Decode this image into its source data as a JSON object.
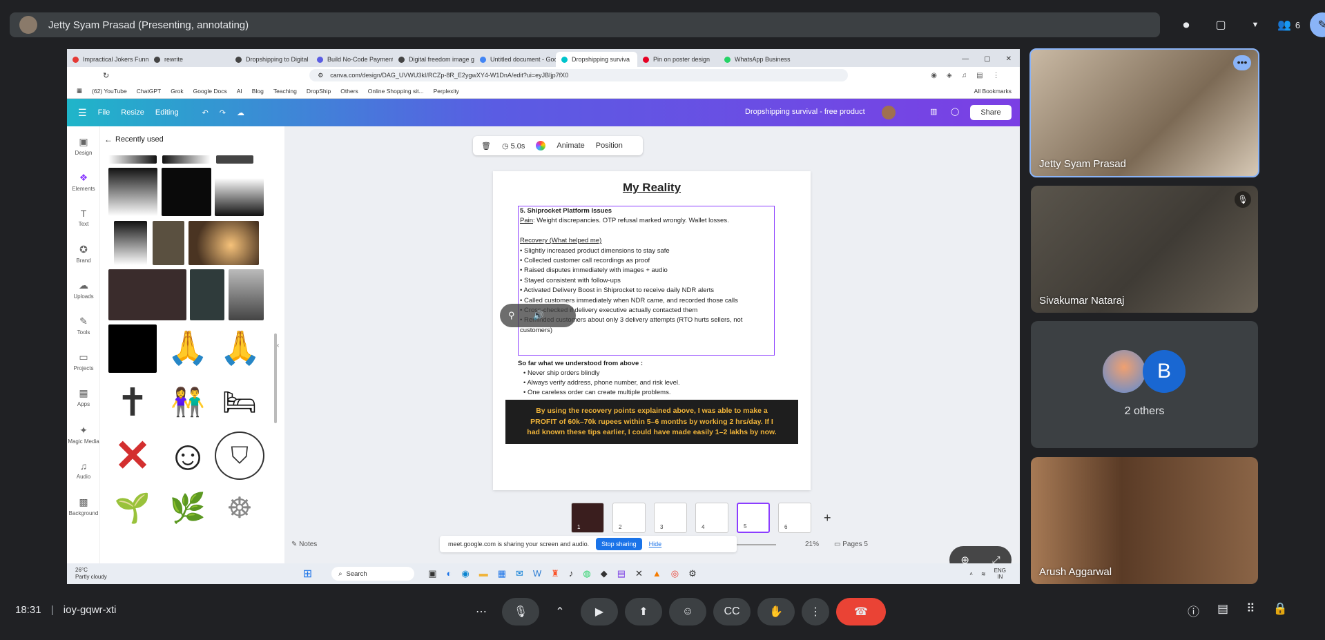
{
  "meet": {
    "presenter_title": "Jetty Syam Prasad (Presenting, annotating)",
    "participant_count": "6",
    "time": "18:31",
    "meeting_code": "ioy-gqwr-xti",
    "participants": [
      {
        "name": "Jetty Syam Prasad"
      },
      {
        "name": "Sivakumar Nataraj"
      },
      {
        "name": "2 others",
        "initial": "B"
      },
      {
        "name": "Arush Aggarwal"
      }
    ]
  },
  "browser": {
    "tabs": [
      {
        "label": "Impractical Jokers Funnies",
        "color": "#e53935"
      },
      {
        "label": "rewrite",
        "color": "#444444"
      },
      {
        "label": "Dropshipping to Digital",
        "color": "#444444"
      },
      {
        "label": "Build No-Code Payment",
        "color": "#5a5ce3"
      },
      {
        "label": "Digital freedom image g",
        "color": "#444444"
      },
      {
        "label": "Untitled document - Goo",
        "color": "#4285f4"
      },
      {
        "label": "Dropshipping surviva",
        "color": "#00c4cc"
      },
      {
        "label": "Pin on poster design",
        "color": "#e60023"
      },
      {
        "label": "WhatsApp Business",
        "color": "#25d366"
      }
    ],
    "url": "canva.com/design/DAG_UVWU3kI/RCZp-8R_E2ygwXY4-W1DnA/edit?ui=eyJBIjp7fX0",
    "bookmarks": [
      "(62) YouTube",
      "ChatGPT",
      "Grok",
      "Google Docs",
      "AI",
      "Blog",
      "Teaching",
      "DropShip",
      "Others",
      "Online Shopping sit...",
      "Perplexity"
    ],
    "all_bookmarks": "All Bookmarks"
  },
  "canva": {
    "menu": {
      "file": "File",
      "resize": "Resize",
      "editing": "Editing"
    },
    "doc_title": "Dropshipping survival - free product",
    "share": "Share",
    "rail": [
      "Design",
      "Elements",
      "Text",
      "Brand",
      "Uploads",
      "Tools",
      "Projects",
      "Apps",
      "Magic Media",
      "Audio",
      "Background"
    ],
    "panel_title": "Recently used",
    "toolbar": {
      "duration": "5.0s",
      "animate": "Animate",
      "position": "Position"
    },
    "notes": "Notes",
    "zoom": "21%",
    "pages_label": "Pages",
    "page_count": "5",
    "pages": [
      "1",
      "2",
      "3",
      "4",
      "5",
      "6"
    ],
    "slide": {
      "heading": "My Reality",
      "section_title": "5. Shiprocket Platform Issues",
      "pain_label": "Pain",
      "pain_text": ": Weight discrepancies. OTP refusal marked wrongly. Wallet losses.",
      "recovery_label": "Recovery (What helped me)",
      "recovery_items": [
        "• Slightly increased product dimensions to stay safe",
        "• Collected customer call recordings as proof",
        "• Raised disputes immediately with images + audio",
        "• Stayed consistent with follow-ups",
        "• Activated Delivery Boost in Shiprocket to receive daily NDR alerts",
        "• Called customers immediately when NDR came, and recorded those calls",
        "• Cross-checked if delivery executive actually contacted them",
        "• Reminded customers about only 3 delivery attempts (RTO hurts sellers, not"
      ],
      "recovery_tail": "customers)",
      "understood_title": "So far what we understood from above :",
      "understood_items": [
        "• Never ship orders blindly",
        "• Always verify address, phone number, and risk level.",
        "• One careless order can create multiple problems."
      ],
      "highlight_lines": [
        "By using the recovery points explained above, I was able to make a",
        "PROFIT of 60k–70k rupees within 5–6 months by working 2 hrs/day. If I",
        "had known these tips earlier, I could have made easily 1–2 lakhs by now."
      ]
    }
  },
  "sharing_bar": {
    "text": "meet.google.com is sharing your screen and audio.",
    "stop": "Stop sharing",
    "hide": "Hide"
  },
  "taskbar": {
    "weather_temp": "26°C",
    "weather_desc": "Partly cloudy",
    "search": "Search",
    "lang": "ENG",
    "region": "IN"
  },
  "colors": {
    "meet_bg": "#202124",
    "end_call": "#ea4335",
    "canva_purple": "#8b3dff",
    "highlight_text": "#f0b43a"
  }
}
